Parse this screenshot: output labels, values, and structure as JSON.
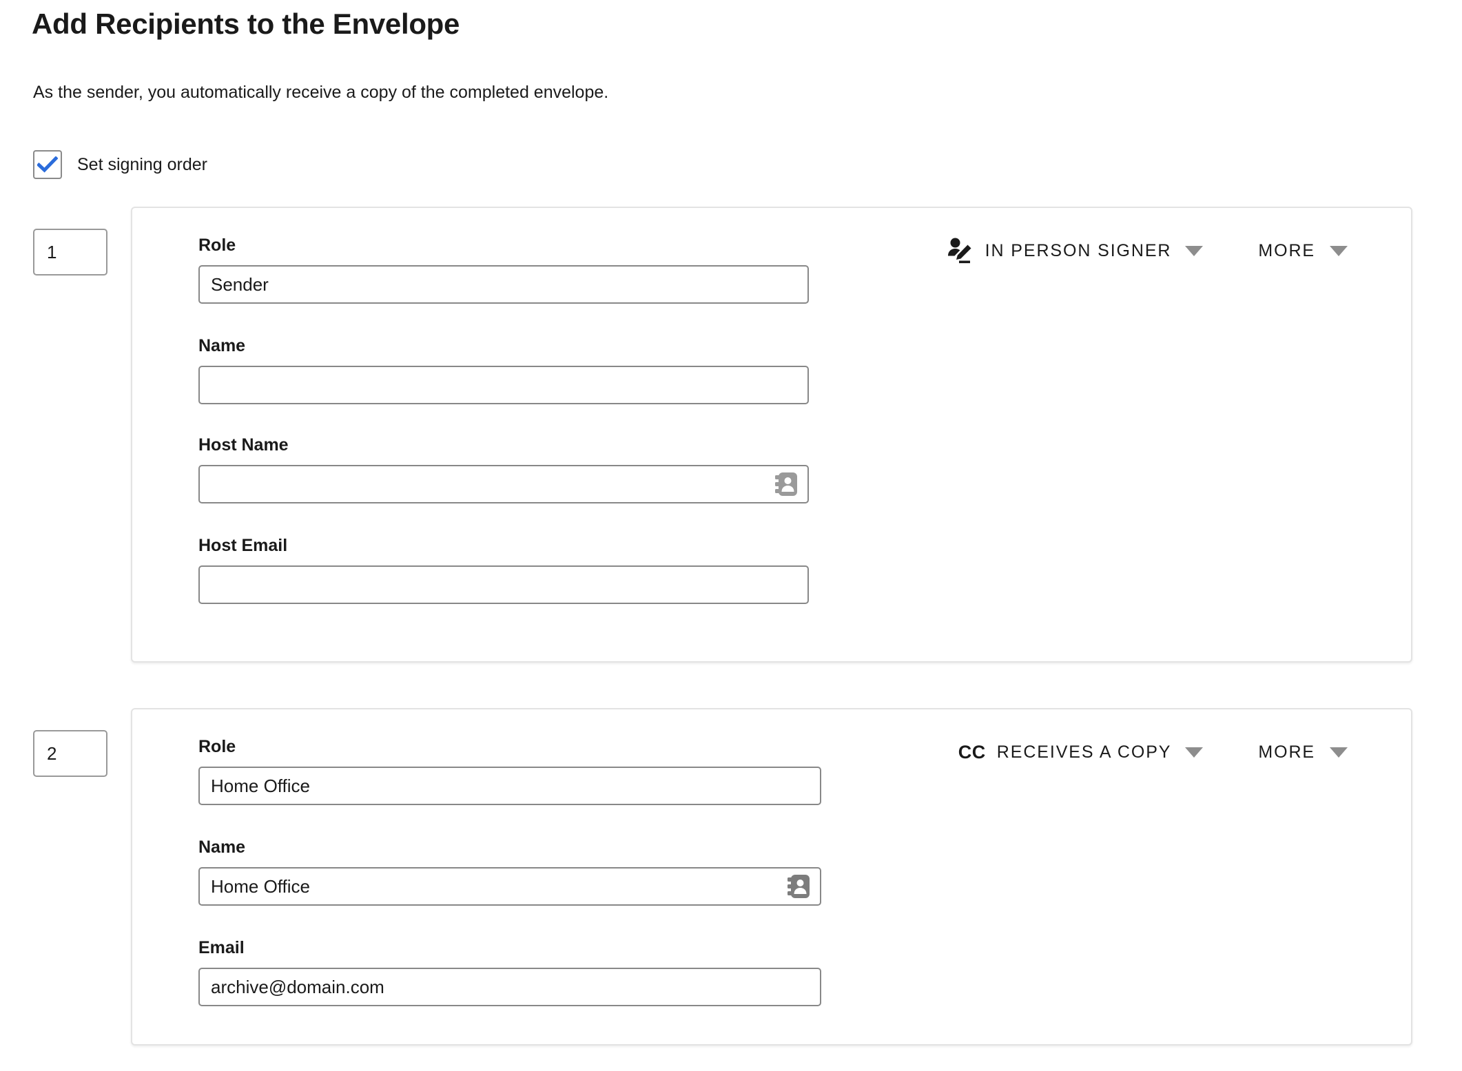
{
  "header": {
    "title": "Add Recipients to the Envelope",
    "subtitle": "As the sender, you automatically receive a copy of the completed envelope."
  },
  "signing_order": {
    "label": "Set signing order",
    "checked": true,
    "check_color": "#2b6cdb",
    "box_border_color": "#8a8a8a"
  },
  "labels": {
    "more": "MORE",
    "role": "Role",
    "name": "Name",
    "host_name": "Host Name",
    "host_email": "Host Email",
    "email": "Email"
  },
  "recipients": [
    {
      "order": "1",
      "type_label": "IN PERSON SIGNER",
      "type_icon": "in-person-signer-icon",
      "more_label": "MORE",
      "fields": [
        {
          "label": "Role",
          "value": "Sender",
          "placeholder": "",
          "has_addressbook": false
        },
        {
          "label": "Name",
          "value": "",
          "placeholder": "",
          "has_addressbook": false
        },
        {
          "label": "Host Name",
          "value": "",
          "placeholder": "",
          "has_addressbook": true
        },
        {
          "label": "Host Email",
          "value": "",
          "placeholder": "",
          "has_addressbook": false
        }
      ]
    },
    {
      "order": "2",
      "type_label": "RECEIVES A COPY",
      "type_icon": "cc-icon",
      "type_icon_text": "CC",
      "more_label": "MORE",
      "fields": [
        {
          "label": "Role",
          "value": "Home Office",
          "placeholder": "",
          "has_addressbook": false
        },
        {
          "label": "Name",
          "value": "Home Office",
          "placeholder": "",
          "has_addressbook": true
        },
        {
          "label": "Email",
          "value": "archive@domain.com",
          "placeholder": "",
          "has_addressbook": false
        }
      ]
    }
  ]
}
